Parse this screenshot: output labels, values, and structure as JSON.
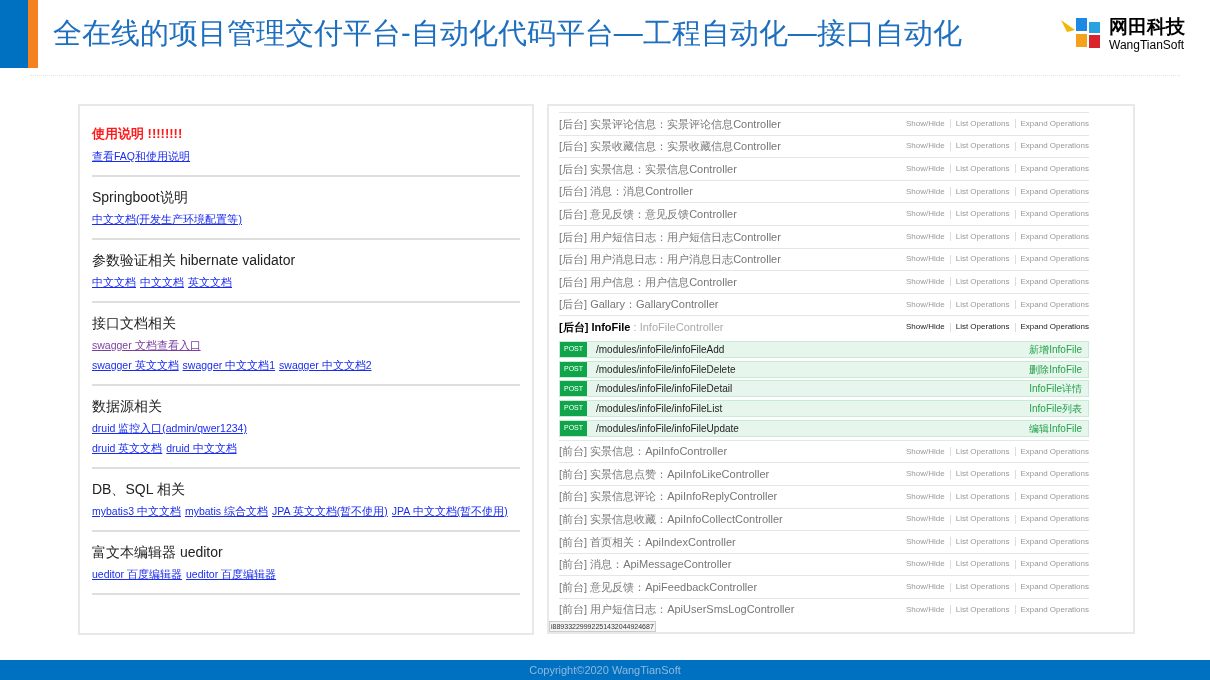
{
  "header": {
    "title": "全在线的项目管理交付平台-自动化代码平台—工程自动化—接口自动化",
    "logo": {
      "name": "网田科技",
      "subtitle": "WangTianSoft"
    }
  },
  "left_panel": {
    "sections": [
      {
        "heading": "使用说明 !!!!!!!!",
        "kind": "warning",
        "lines": [
          [
            {
              "text": "查看FAQ和使用说明",
              "visited": false
            }
          ]
        ]
      },
      {
        "heading": "Springboot说明",
        "kind": "normal",
        "lines": [
          [
            {
              "text": "中文文档(开发生产环境配置等)",
              "visited": false
            }
          ]
        ]
      },
      {
        "heading": "参数验证相关 hibernate validator",
        "kind": "normal",
        "lines": [
          [
            {
              "text": "中文文档",
              "visited": false
            },
            {
              "text": "中文文档",
              "visited": false
            },
            {
              "text": "英文文档",
              "visited": false
            }
          ]
        ]
      },
      {
        "heading": "接口文档相关",
        "kind": "normal",
        "lines": [
          [
            {
              "text": "swagger 文档查看入口",
              "visited": true
            }
          ],
          [
            {
              "text": "swagger 英文文档",
              "visited": false
            },
            {
              "text": "swagger 中文文档1",
              "visited": false
            },
            {
              "text": "swagger 中文文档2",
              "visited": false
            }
          ]
        ]
      },
      {
        "heading": "数据源相关",
        "kind": "normal",
        "lines": [
          [
            {
              "text": "druid 监控入口(admin/qwer1234)",
              "visited": false
            }
          ],
          [
            {
              "text": "druid 英文文档",
              "visited": false
            },
            {
              "text": "druid 中文文档",
              "visited": false
            }
          ]
        ]
      },
      {
        "heading": "DB、SQL 相关",
        "kind": "normal",
        "lines": [
          [
            {
              "text": "mybatis3 中文文档",
              "visited": false
            },
            {
              "text": "mybatis 综合文档",
              "visited": false
            },
            {
              "text": "JPA 英文文档(暂不使用)",
              "visited": false
            },
            {
              "text": "JPA 中文文档(暂不使用)",
              "visited": false
            }
          ]
        ]
      },
      {
        "heading": "富文本编辑器 ueditor",
        "kind": "normal",
        "lines": [
          [
            {
              "text": "ueditor 百度编辑器",
              "visited": false
            },
            {
              "text": "ueditor 百度编辑器",
              "visited": false
            }
          ]
        ]
      }
    ]
  },
  "right_panel": {
    "groups": [
      {
        "title": "[后台] 实景评论信息：实景评论信息Controller",
        "expanded": false,
        "actions": [
          "Show/Hide",
          "List Operations",
          "Expand Operations"
        ]
      },
      {
        "title": "[后台] 实景收藏信息：实景收藏信息Controller",
        "expanded": false,
        "actions": [
          "Show/Hide",
          "List Operations",
          "Expand Operations"
        ]
      },
      {
        "title": "[后台] 实景信息：实景信息Controller",
        "expanded": false,
        "actions": [
          "Show/Hide",
          "List Operations",
          "Expand Operations"
        ]
      },
      {
        "title": "[后台] 消息：消息Controller",
        "expanded": false,
        "actions": [
          "Show/Hide",
          "List Operations",
          "Expand Operations"
        ]
      },
      {
        "title": "[后台] 意见反馈：意见反馈Controller",
        "expanded": false,
        "actions": [
          "Show/Hide",
          "List Operations",
          "Expand Operations"
        ]
      },
      {
        "title": "[后台] 用户短信日志：用户短信日志Controller",
        "expanded": false,
        "actions": [
          "Show/Hide",
          "List Operations",
          "Expand Operations"
        ]
      },
      {
        "title": "[后台] 用户消息日志：用户消息日志Controller",
        "expanded": false,
        "actions": [
          "Show/Hide",
          "List Operations",
          "Expand Operations"
        ]
      },
      {
        "title": "[后台] 用户信息：用户信息Controller",
        "expanded": false,
        "actions": [
          "Show/Hide",
          "List Operations",
          "Expand Operations"
        ]
      },
      {
        "title": "[后台] Gallary：GallaryController",
        "expanded": false,
        "actions": [
          "Show/Hide",
          "List Operations",
          "Expand Operations"
        ]
      },
      {
        "title": "**[后台] InfoFile** : InfoFileController",
        "expanded": true,
        "actions": [
          "Show/Hide",
          "List Operations",
          "Expand Operations"
        ],
        "operations": [
          {
            "method": "POST",
            "path": "/modules/infoFile/infoFileAdd",
            "summary": "新增InfoFile"
          },
          {
            "method": "POST",
            "path": "/modules/infoFile/infoFileDelete",
            "summary": "删除InfoFile"
          },
          {
            "method": "POST",
            "path": "/modules/infoFile/infoFileDetail",
            "summary": "InfoFile详情"
          },
          {
            "method": "POST",
            "path": "/modules/infoFile/infoFileList",
            "summary": "InfoFile列表"
          },
          {
            "method": "POST",
            "path": "/modules/infoFile/infoFileUpdate",
            "summary": "编辑InfoFile"
          }
        ]
      },
      {
        "title": "[前台] 实景信息：ApiInfoController",
        "expanded": false,
        "actions": [
          "Show/Hide",
          "List Operations",
          "Expand Operations"
        ]
      },
      {
        "title": "[前台] 实景信息点赞：ApiInfoLikeController",
        "expanded": false,
        "actions": [
          "Show/Hide",
          "List Operations",
          "Expand Operations"
        ]
      },
      {
        "title": "[前台] 实景信息评论：ApiInfoReplyController",
        "expanded": false,
        "actions": [
          "Show/Hide",
          "List Operations",
          "Expand Operations"
        ]
      },
      {
        "title": "[前台] 实景信息收藏：ApiInfoCollectController",
        "expanded": false,
        "actions": [
          "Show/Hide",
          "List Operations",
          "Expand Operations"
        ]
      },
      {
        "title": "[前台] 首页相关：ApiIndexController",
        "expanded": false,
        "actions": [
          "Show/Hide",
          "List Operations",
          "Expand Operations"
        ]
      },
      {
        "title": "[前台] 消息：ApiMessageController",
        "expanded": false,
        "actions": [
          "Show/Hide",
          "List Operations",
          "Expand Operations"
        ]
      },
      {
        "title": "[前台] 意见反馈：ApiFeedbackController",
        "expanded": false,
        "actions": [
          "Show/Hide",
          "List Operations",
          "Expand Operations"
        ]
      },
      {
        "title": "[前台] 用户短信日志：ApiUserSmsLogController",
        "expanded": false,
        "actions": [
          "Show/Hide",
          "List Operations",
          "Expand Operations"
        ]
      }
    ],
    "status_tooltip": "i88933229992251432044924687"
  },
  "footer": {
    "copyright": "Copyright©2020 WangTianSoft"
  }
}
